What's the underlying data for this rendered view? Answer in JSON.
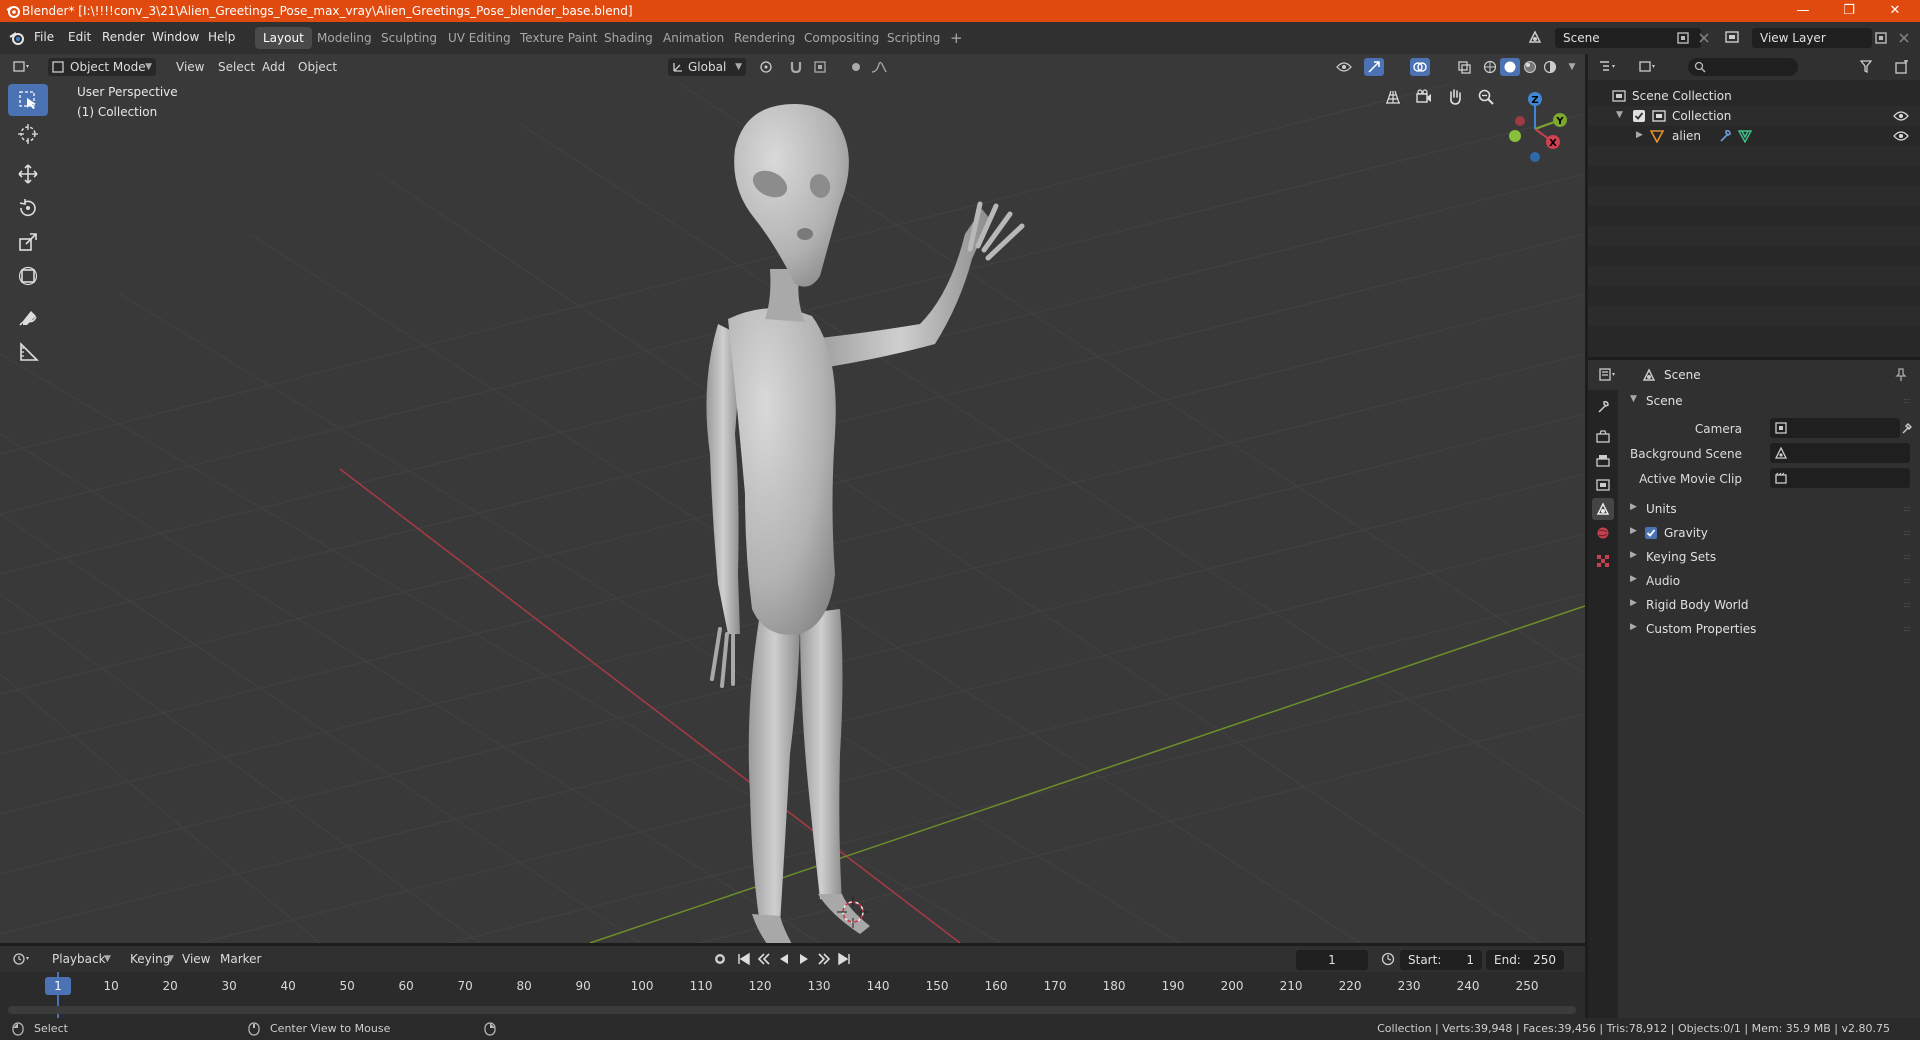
{
  "window": {
    "title": "Blender* [I:\\!!!!conv_3\\21\\Alien_Greetings_Pose_max_vray\\Alien_Greetings_Pose_blender_base.blend]",
    "minimize": "—",
    "restore": "❐",
    "close": "✕"
  },
  "menu": [
    "File",
    "Edit",
    "Render",
    "Window",
    "Help"
  ],
  "workspaces": [
    "Layout",
    "Modeling",
    "Sculpting",
    "UV Editing",
    "Texture Paint",
    "Shading",
    "Animation",
    "Rendering",
    "Compositing",
    "Scripting"
  ],
  "workspace_add": "+",
  "scene_field": "Scene",
  "view_layer_field": "View Layer",
  "viewport": {
    "mode": "Object Mode",
    "menus": [
      "View",
      "Select",
      "Add",
      "Object"
    ],
    "transform_orientation": "Global",
    "info_line1": "User Perspective",
    "info_line2": "(1) Collection",
    "gizmo": {
      "z": "Z",
      "y": "Y",
      "x": "X"
    },
    "object": "alien"
  },
  "outliner": {
    "scene_collection": "Scene Collection",
    "collection": "Collection",
    "object": "alien"
  },
  "properties": {
    "context": "Scene",
    "panel": "Scene",
    "camera_label": "Camera",
    "background_scene_label": "Background Scene",
    "active_movie_clip_label": "Active Movie Clip",
    "subpanels": [
      "Units",
      "Gravity",
      "Keying Sets",
      "Audio",
      "Rigid Body World",
      "Custom Properties"
    ],
    "gravity_checked": true
  },
  "timeline": {
    "menus": [
      "Playback",
      "Keying",
      "View",
      "Marker"
    ],
    "current_frame": "1",
    "start_label": "Start:",
    "start_value": "1",
    "end_label": "End:",
    "end_value": "250",
    "ticks": [
      "1",
      "10",
      "20",
      "30",
      "40",
      "50",
      "60",
      "70",
      "80",
      "90",
      "100",
      "110",
      "120",
      "130",
      "140",
      "150",
      "160",
      "170",
      "180",
      "190",
      "200",
      "210",
      "220",
      "230",
      "240",
      "250"
    ]
  },
  "statusbar": {
    "select": "Select",
    "center_view": "Center View to Mouse",
    "stats": "Collection | Verts:39,948 | Faces:39,456 | Tris:78,912 | Objects:0/1 | Mem: 35.9 MB | v2.80.75"
  },
  "colors": {
    "title_bar": "#e04a0f",
    "accent": "#4b72b3",
    "x_axis": "#d1404f",
    "y_axis": "#7ea72f",
    "z_axis": "#3f87d6"
  }
}
